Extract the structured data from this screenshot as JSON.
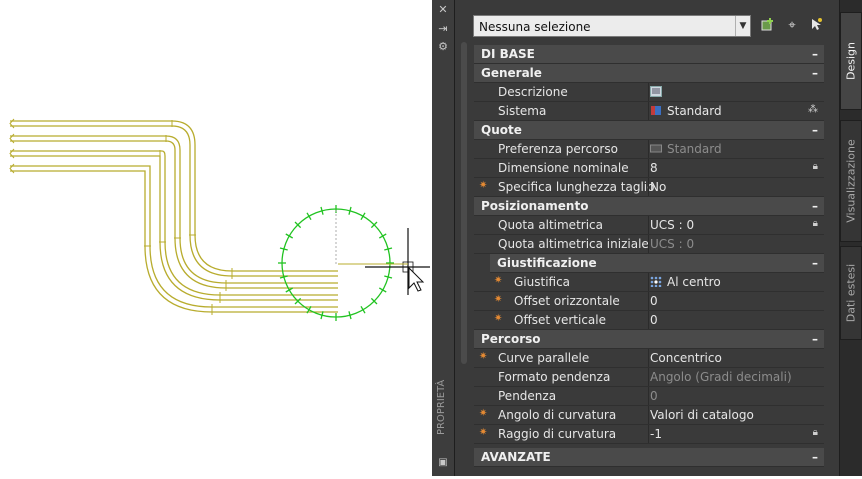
{
  "palette": {
    "title": "PROPRIETÀ",
    "controls": {
      "close_icon": "close-icon",
      "autohide_icon": "autohide-icon",
      "settings_icon": "settings-icon"
    }
  },
  "selection": {
    "value": "Nessuna selezione",
    "buttons": [
      "add-selection-icon",
      "select-objects-icon",
      "quick-select-icon"
    ]
  },
  "categories": {
    "base": "DI BASE",
    "generale": "Generale",
    "quote": "Quote",
    "posizionamento": "Posizionamento",
    "giustificazione": "Giustificazione",
    "percorso": "Percorso",
    "avanzate": "AVANZATE"
  },
  "props": {
    "descrizione": {
      "label": "Descrizione",
      "value": ""
    },
    "sistema": {
      "label": "Sistema",
      "value": "Standard"
    },
    "preferenza": {
      "label": "Preferenza percorso",
      "value": "Standard"
    },
    "dimensione": {
      "label": "Dimensione nominale",
      "value": "8"
    },
    "lunghezza": {
      "label": "Specifica lunghezza taglio",
      "value": "No"
    },
    "quota": {
      "label": "Quota altimetrica",
      "value": "UCS : 0"
    },
    "quota_iniziale": {
      "label": "Quota altimetrica iniziale",
      "value": "UCS : 0"
    },
    "giustifica": {
      "label": "Giustifica",
      "value": "Al centro"
    },
    "offset_orizz": {
      "label": "Offset orizzontale",
      "value": "0"
    },
    "offset_vert": {
      "label": "Offset verticale",
      "value": "0"
    },
    "curve": {
      "label": "Curve parallele",
      "value": "Concentrico"
    },
    "formato": {
      "label": "Formato pendenza",
      "value": "Angolo (Gradi decimali)"
    },
    "pendenza": {
      "label": "Pendenza",
      "value": "0"
    },
    "angolo": {
      "label": "Angolo di curvatura",
      "value": "Valori di catalogo"
    },
    "raggio": {
      "label": "Raggio di curvatura",
      "value": "-1"
    }
  },
  "tabs": [
    "Design",
    "Visualizzazione",
    "Dati estesi"
  ],
  "colors": {
    "pipe": "#b8ac2e",
    "circle": "#22c322",
    "required_marker": "#e58a33"
  }
}
